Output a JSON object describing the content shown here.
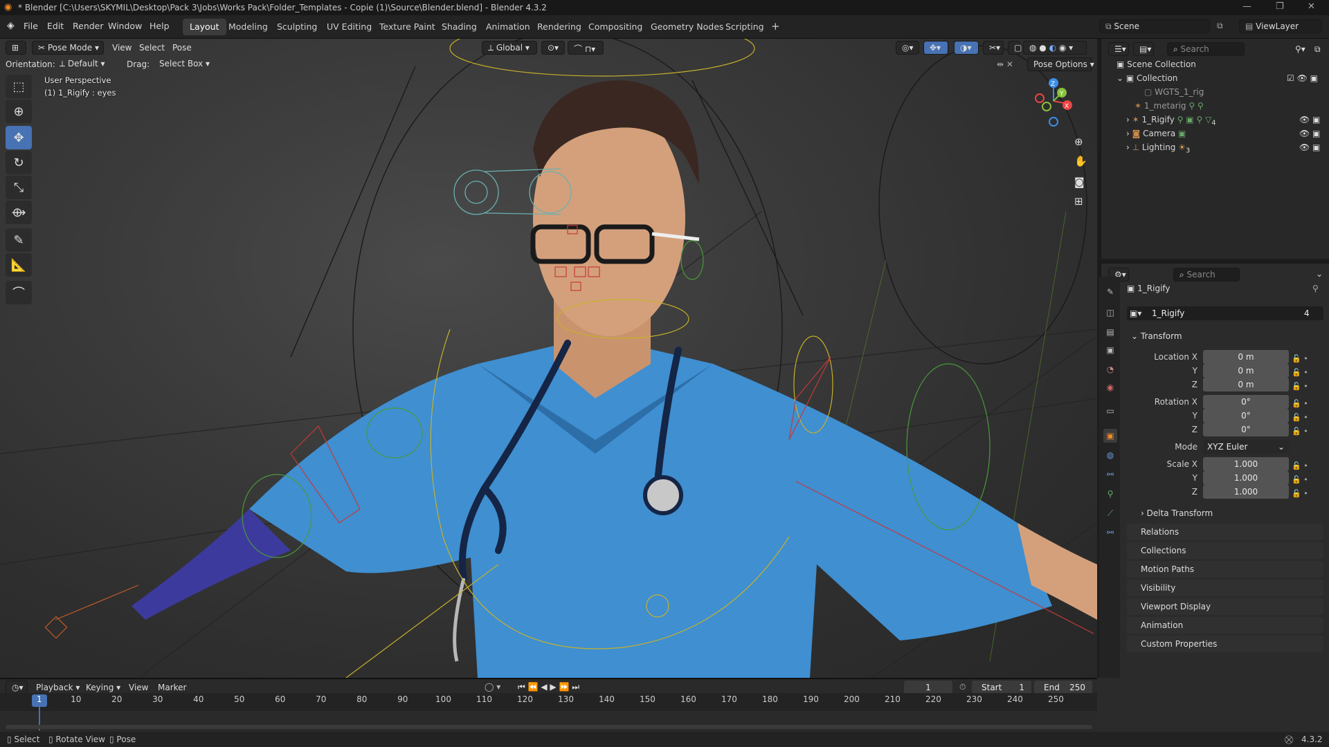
{
  "window": {
    "title": "* Blender [C:\\Users\\SKYMIL\\Desktop\\Pack 3\\Jobs\\Works Pack\\Folder_Templates - Copie (1)\\Source\\Blender.blend] - Blender 4.3.2"
  },
  "menu": [
    "File",
    "Edit",
    "Render",
    "Window",
    "Help"
  ],
  "workspaces": [
    "Layout",
    "Modeling",
    "Sculpting",
    "UV Editing",
    "Texture Paint",
    "Shading",
    "Animation",
    "Rendering",
    "Compositing",
    "Geometry Nodes",
    "Scripting"
  ],
  "active_workspace": "Layout",
  "topright": {
    "scene": "Scene",
    "viewlayer": "ViewLayer"
  },
  "viewport_header": {
    "mode": "Pose Mode",
    "menus": [
      "View",
      "Select",
      "Pose"
    ],
    "transform_orientation": "Global",
    "orientation_label": "Orientation:",
    "orientation_value": "Default",
    "drag_label": "Drag:",
    "drag_value": "Select Box",
    "pose_options": "Pose Options"
  },
  "viewport_overlay": {
    "perspective": "User Perspective",
    "active": "(1) 1_Rigify : eyes"
  },
  "outliner": {
    "search_placeholder": "Search",
    "root": "Scene Collection",
    "collection": "Collection",
    "items": [
      {
        "name": "WGTS_1_rig",
        "color": "#9a9a9a"
      },
      {
        "name": "1_metarig",
        "color": "#9a9a9a"
      },
      {
        "name": "1_Rigify",
        "color": "#e0e0e0"
      },
      {
        "name": "Camera",
        "color": "#e0e0e0"
      },
      {
        "name": "Lighting",
        "color": "#e0e0e0"
      }
    ],
    "rigify_badge": "4",
    "lighting_badge": "3"
  },
  "properties": {
    "search_placeholder": "Search",
    "object_name": "1_Rigify",
    "data_name": "1_Rigify",
    "data_users": "4",
    "transform_title": "Transform",
    "location": {
      "label": "Location X",
      "x": "0 m",
      "y": "0 m",
      "z": "0 m"
    },
    "rotation": {
      "label": "Rotation X",
      "x": "0°",
      "y": "0°",
      "z": "0°"
    },
    "mode_label": "Mode",
    "mode_value": "XYZ Euler",
    "scale": {
      "label": "Scale X",
      "x": "1.000",
      "y": "1.000",
      "z": "1.000"
    },
    "axis_y": "Y",
    "axis_z": "Z",
    "delta_transform": "Delta Transform",
    "panels": [
      "Relations",
      "Collections",
      "Motion Paths",
      "Visibility",
      "Viewport Display",
      "Animation",
      "Custom Properties"
    ]
  },
  "timeline": {
    "menus": [
      "Playback",
      "Keying",
      "View",
      "Marker"
    ],
    "current_frame": "1",
    "start_label": "Start",
    "start": "1",
    "end_label": "End",
    "end": "250",
    "ticks": [
      "1",
      "10",
      "20",
      "30",
      "40",
      "50",
      "60",
      "70",
      "80",
      "90",
      "100",
      "110",
      "120",
      "130",
      "140",
      "150",
      "160",
      "170",
      "180",
      "190",
      "200",
      "210",
      "220",
      "230",
      "240",
      "250"
    ]
  },
  "statusbar": {
    "select": "Select",
    "rotate": "Rotate View",
    "pose": "Pose",
    "version": "4.3.2"
  },
  "colors": {
    "accent": "#4772b3",
    "scrub_blue": "#4772b3",
    "gizmo_x": "#e84545",
    "gizmo_y": "#86c23b",
    "gizmo_z": "#3b8fe8",
    "scrubs": "#3f8fd1"
  }
}
